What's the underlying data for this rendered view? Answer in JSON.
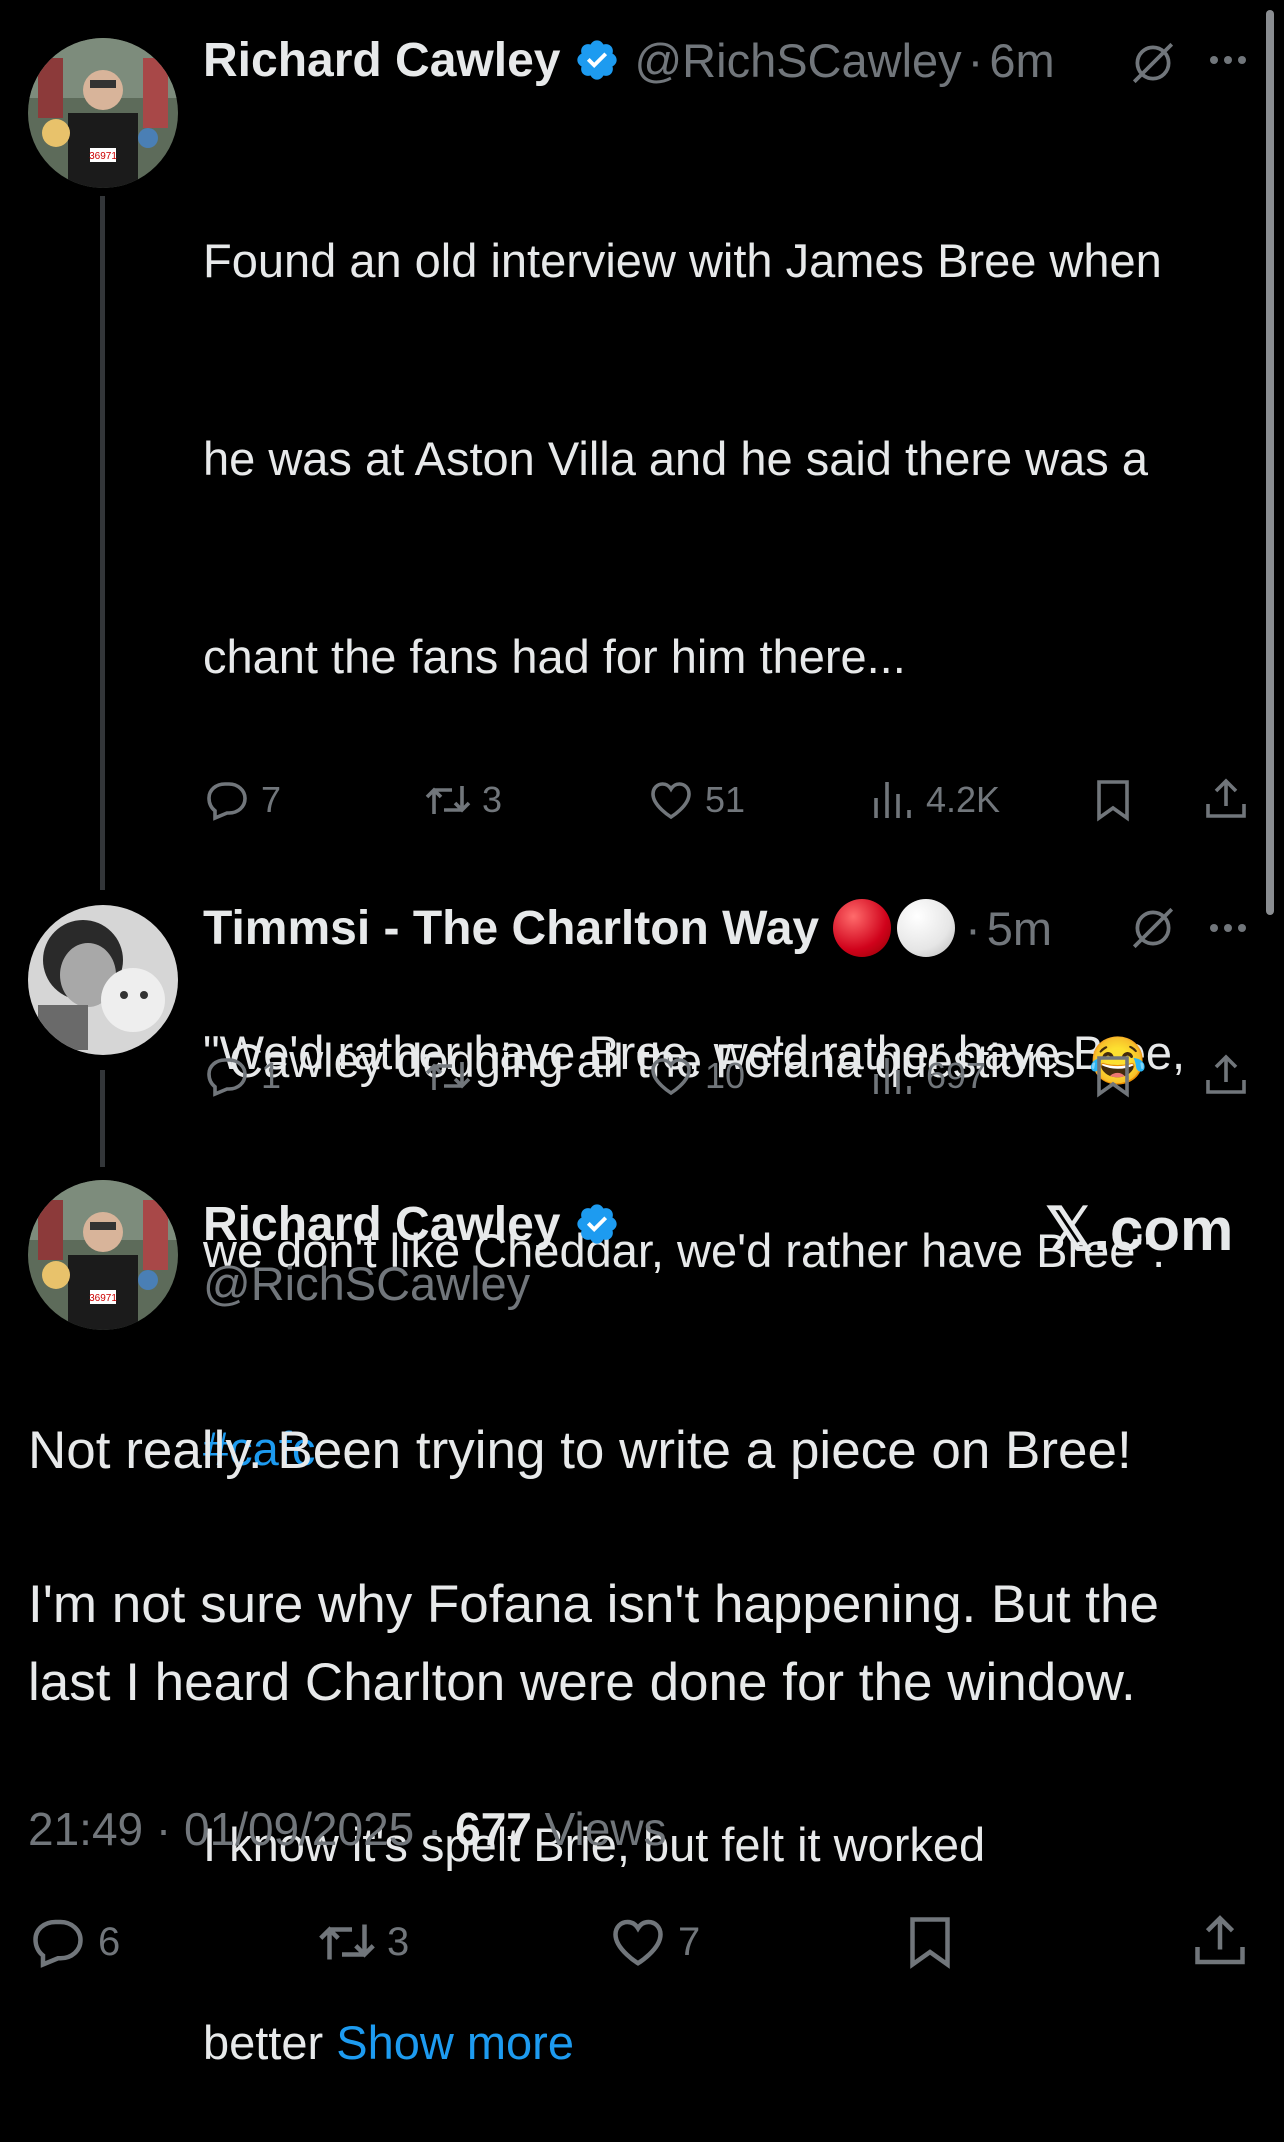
{
  "tweet1": {
    "name": "Richard Cawley",
    "handle": "@RichSCawley",
    "sep": "·",
    "time": "6m",
    "text_lines": [
      "Found an old interview with James Bree when",
      "he was at Aston Villa and he said there was a",
      "chant the fans had for him there...",
      "",
      "\"We'd rather have Bree, we'd rather have Bree,",
      "we don't like Cheddar, we'd rather have Bree\"."
    ],
    "hashtag": "#cafc",
    "text_lines2": [
      "I know it's spelt Brie, but felt it worked"
    ],
    "last_line": "better",
    "show_more": "Show more",
    "replies": "7",
    "reposts": "3",
    "likes": "51",
    "views": "4.2K"
  },
  "tweet2": {
    "name": "Timmsi - The Charlton Way",
    "sep": "·",
    "time": "5m",
    "text": "Cawley dodging all the Fofana questions",
    "emoji": "😂",
    "replies": "1",
    "likes": "10",
    "views": "697"
  },
  "tweet3": {
    "name": "Richard Cawley",
    "handle": "@RichSCawley",
    "brand": "𝕏.com",
    "para1": "Not really. Been trying to write a piece on Bree!",
    "para2_line1": "I'm not sure why Fofana isn't happening. But the",
    "para2_line2": "last I heard Charlton were done for the window.",
    "time": "21:49",
    "sep1": "·",
    "date": "01/09/2025",
    "sep2": "·",
    "views_count": "677",
    "views_label": "Views",
    "replies": "6",
    "reposts": "3",
    "likes": "7"
  },
  "colors": {
    "accent": "#1d9bf0",
    "muted": "#71767b",
    "background": "#000000",
    "text": "#e7e9ea"
  },
  "icons": [
    "verified-badge-icon",
    "grok-icon",
    "more-icon",
    "reply-icon",
    "repost-icon",
    "like-icon",
    "views-icon",
    "bookmark-icon",
    "share-icon"
  ]
}
